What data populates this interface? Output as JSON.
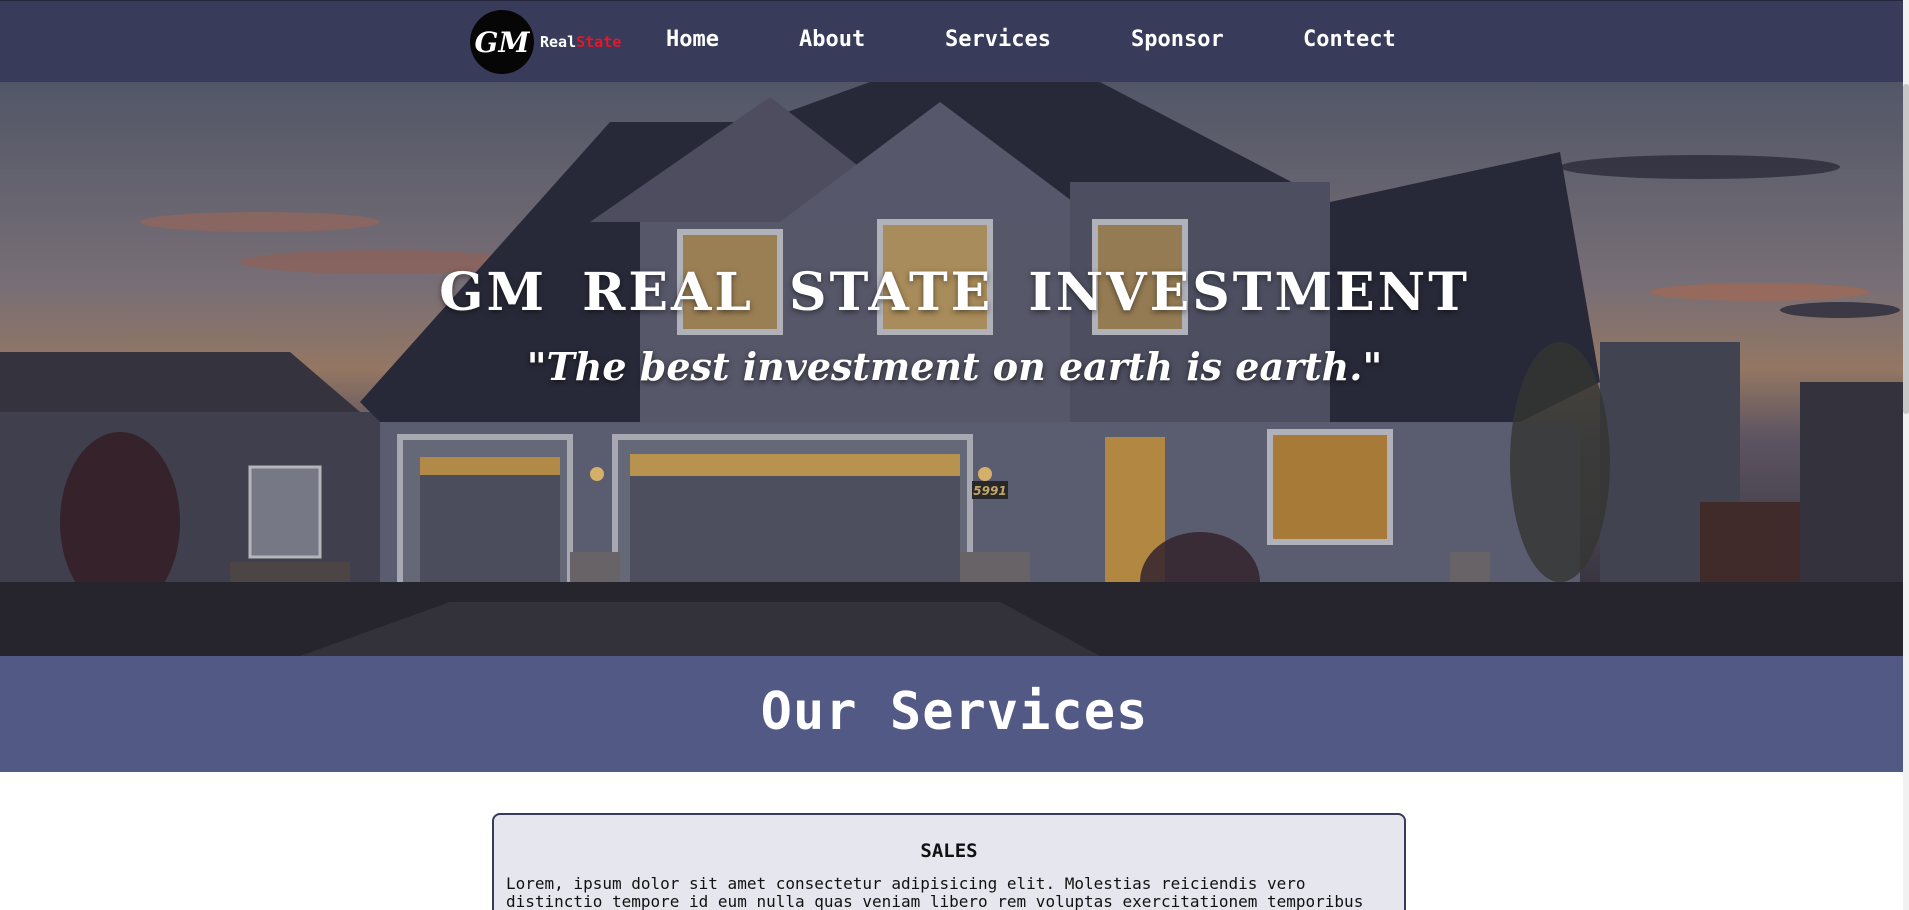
{
  "nav": {
    "brand_part1": "Real",
    "brand_part2": "State",
    "logo_text": "GM",
    "links": [
      "Home",
      "About",
      "Services",
      "Sponsor",
      "Contect"
    ]
  },
  "hero": {
    "title": "GM REAL STATE INVESTMENT",
    "quote": "\"The best investment on earth is earth.\"",
    "house_number": "5991"
  },
  "services": {
    "heading": "Our Services",
    "cards": [
      {
        "title": "SALES",
        "text": "Lorem, ipsum dolor sit amet consectetur adipisicing elit. Molestias reiciendis vero distinctio tempore id eum nulla quas veniam libero rem voluptas exercitationem temporibus"
      }
    ]
  },
  "colors": {
    "navbar": "#383b5a",
    "banner": "#535985",
    "brand_accent": "#e3182a",
    "card_bg": "#e6e6ee"
  }
}
